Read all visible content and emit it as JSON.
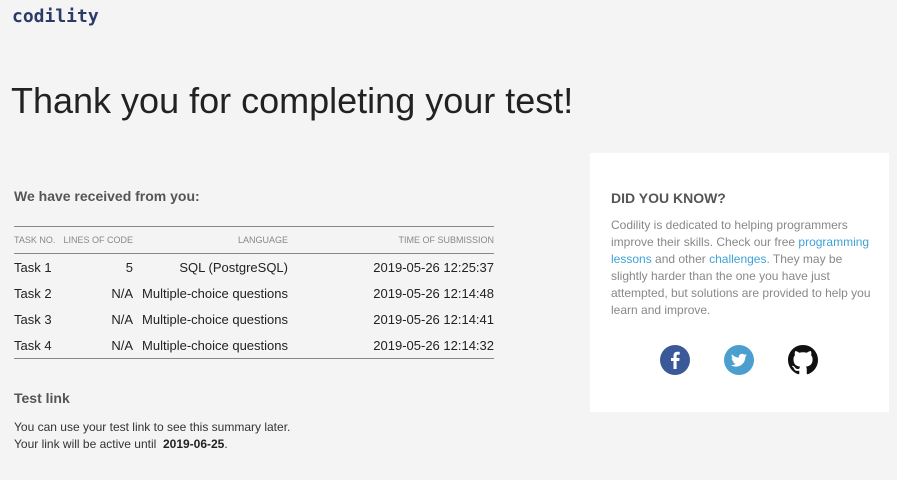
{
  "header": {
    "logo_text": "codility"
  },
  "page": {
    "title": "Thank you for completing your test!",
    "received_heading": "We have received from you:"
  },
  "table": {
    "columns": {
      "task": "TASK NO.",
      "lines": "LINES OF CODE",
      "language": "LANGUAGE",
      "time": "TIME OF SUBMISSION"
    },
    "rows": [
      {
        "task": "Task 1",
        "lines": "5",
        "language": "SQL (PostgreSQL)",
        "time": "2019-05-26 12:25:37"
      },
      {
        "task": "Task 2",
        "lines": "N/A",
        "language": "Multiple-choice questions",
        "time": "2019-05-26 12:14:48"
      },
      {
        "task": "Task 3",
        "lines": "N/A",
        "language": "Multiple-choice questions",
        "time": "2019-05-26 12:14:41"
      },
      {
        "task": "Task 4",
        "lines": "N/A",
        "language": "Multiple-choice questions",
        "time": "2019-05-26 12:14:32"
      }
    ]
  },
  "test_link": {
    "heading": "Test link",
    "line1": "You can use your test link to see this summary later.",
    "line2_prefix": "Your link will be active until",
    "active_until": "2019-06-25",
    "line2_suffix": "."
  },
  "did_you_know": {
    "heading": "DID YOU KNOW?",
    "text_part1": "Codility is dedicated to helping programmers improve their skills. Check our free",
    "link1": "programming lessons",
    "text_part2": "and other",
    "link2": "challenges",
    "text_part3": ". They may be slightly harder than the one you have just attempted, but solutions are provided to help you learn and improve."
  },
  "social": {
    "facebook_icon": "facebook-icon",
    "twitter_icon": "twitter-icon",
    "github_icon": "github-icon"
  },
  "colors": {
    "logo": "#2b3a67",
    "link": "#3ea2d8",
    "facebook": "#3b5998",
    "twitter": "#4a9ed0",
    "github": "#111111",
    "background": "#f4f4f4"
  }
}
